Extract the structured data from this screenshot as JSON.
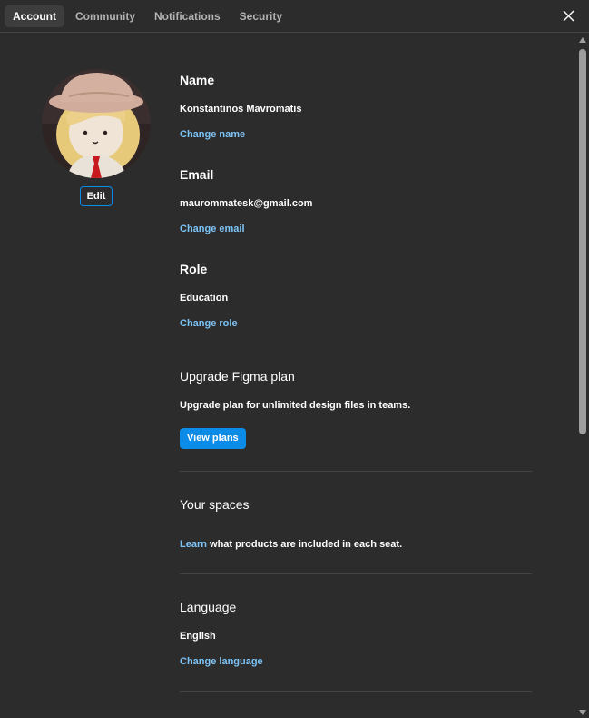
{
  "tabs": [
    {
      "label": "Account"
    },
    {
      "label": "Community"
    },
    {
      "label": "Notifications"
    },
    {
      "label": "Security"
    }
  ],
  "avatar": {
    "edit_label": "Edit"
  },
  "name": {
    "title": "Name",
    "value": "Konstantinos Mavromatis",
    "change_label": "Change name"
  },
  "email": {
    "title": "Email",
    "value": "maurommatesk@gmail.com",
    "change_label": "Change email"
  },
  "role": {
    "title": "Role",
    "value": "Education",
    "change_label": "Change role"
  },
  "upgrade": {
    "title": "Upgrade Figma plan",
    "description": "Upgrade plan for unlimited design files in teams.",
    "button_label": "View plans"
  },
  "spaces": {
    "title": "Your spaces",
    "link_label": "Learn",
    "text": " what products are included in each seat."
  },
  "language": {
    "title": "Language",
    "value": "English",
    "change_label": "Change language"
  },
  "colors": {
    "background": "#2c2c2c",
    "accent": "#0c8ce9",
    "link": "#7cc4f8",
    "divider": "#444444"
  },
  "icons": {
    "close": "close-icon"
  }
}
